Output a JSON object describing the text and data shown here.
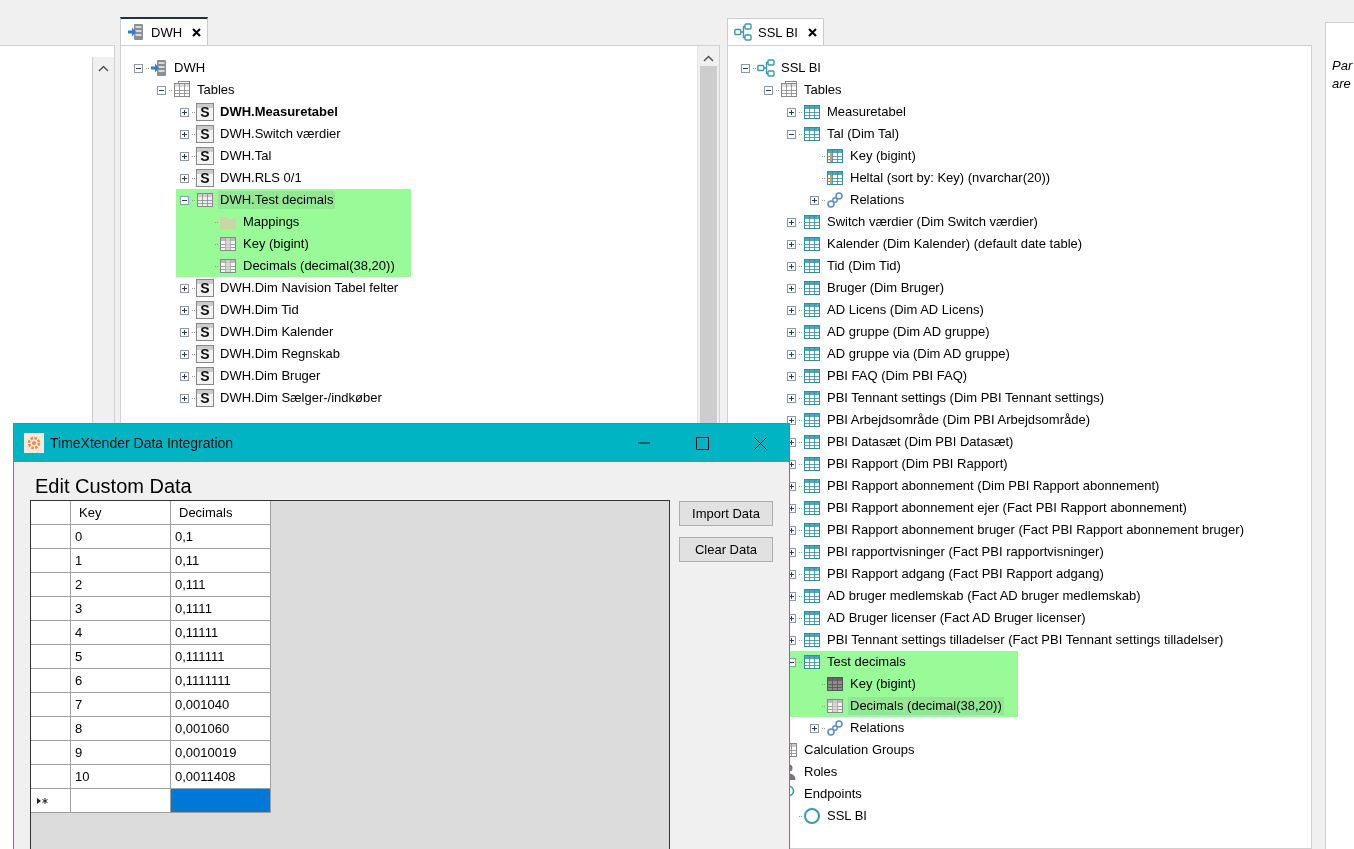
{
  "dwh_pane": {
    "tab": {
      "label": "DWH",
      "kind": "server"
    },
    "tree": [
      {
        "label": "DWH",
        "kind": "server",
        "expanded": true,
        "selected": false,
        "children": [
          {
            "label": "Tables",
            "kind": "tables",
            "expanded": true,
            "selected": false,
            "children": [
              {
                "label": "DWH.Measuretabel",
                "kind": "lettered",
                "icon_letter": "S",
                "expanded": false,
                "selected": false,
                "bold": true,
                "highlighted": false
              },
              {
                "label": "DWH.Switch værdier",
                "kind": "lettered",
                "icon_letter": "S",
                "expanded": false,
                "selected": false,
                "bold": false,
                "highlighted": false
              },
              {
                "label": "DWH.Tal",
                "kind": "lettered",
                "icon_letter": "S",
                "expanded": false,
                "selected": false,
                "bold": false,
                "highlighted": false
              },
              {
                "label": "DWH.RLS 0/1",
                "kind": "lettered",
                "icon_letter": "S",
                "expanded": false,
                "selected": false,
                "bold": false,
                "highlighted": false
              },
              {
                "label": "DWH.Test decimals",
                "kind": "grid",
                "expanded": true,
                "selected": true,
                "bold": false,
                "highlighted": true,
                "children": [
                  {
                    "label": "Mappings",
                    "kind": "folder",
                    "selected": false,
                    "highlighted": true
                  },
                  {
                    "label": "Key (bigint)",
                    "kind": "column",
                    "selected": false,
                    "highlighted": true
                  },
                  {
                    "label": "Decimals (decimal(38,20))",
                    "kind": "column",
                    "selected": false,
                    "highlighted": true
                  }
                ]
              },
              {
                "label": "DWH.Dim Navision Tabel felter",
                "kind": "lettered",
                "icon_letter": "S",
                "expanded": false,
                "selected": false,
                "bold": false,
                "highlighted": false
              },
              {
                "label": "DWH.Dim Tid",
                "kind": "lettered",
                "icon_letter": "S",
                "expanded": false,
                "selected": false,
                "bold": false,
                "highlighted": false
              },
              {
                "label": "DWH.Dim Kalender",
                "kind": "lettered",
                "icon_letter": "S",
                "expanded": false,
                "selected": false,
                "bold": false,
                "highlighted": false
              },
              {
                "label": "DWH.Dim Regnskab",
                "kind": "lettered",
                "icon_letter": "S",
                "expanded": false,
                "selected": false,
                "bold": false,
                "highlighted": false
              },
              {
                "label": "DWH.Dim Bruger",
                "kind": "lettered",
                "icon_letter": "S",
                "expanded": false,
                "selected": false,
                "bold": false,
                "highlighted": false
              },
              {
                "label": "DWH.Dim Sælger-/indkøber",
                "kind": "lettered",
                "icon_letter": "S",
                "expanded": false,
                "selected": false,
                "bold": false,
                "highlighted": false
              }
            ]
          }
        ]
      }
    ]
  },
  "ssl_pane": {
    "tab": {
      "label": "SSL BI",
      "kind": "model"
    },
    "tree": [
      {
        "label": "SSL BI",
        "kind": "model",
        "expanded": true,
        "selected": false,
        "children": [
          {
            "label": "Tables",
            "kind": "tables",
            "expanded": true,
            "selected": false,
            "children": [
              {
                "label": "Measuretabel",
                "kind": "table",
                "expanded": false,
                "selected": false,
                "highlighted": false
              },
              {
                "label": "Tal (Dim Tal)",
                "kind": "table",
                "expanded": true,
                "selected": false,
                "highlighted": false,
                "children": [
                  {
                    "label": "Key (bigint)",
                    "kind": "columnaccent",
                    "selected": false
                  },
                  {
                    "label": "Heltal (sort by: Key) (nvarchar(20))",
                    "kind": "columnaccent",
                    "selected": false
                  },
                  {
                    "label": "Relations",
                    "kind": "relations",
                    "expanded": false,
                    "selected": false
                  }
                ]
              },
              {
                "label": "Switch værdier (Dim Switch værdier)",
                "kind": "table",
                "expanded": false,
                "selected": false,
                "highlighted": false
              },
              {
                "label": "Kalender (Dim Kalender) (default date table)",
                "kind": "table",
                "expanded": false,
                "selected": false,
                "highlighted": false
              },
              {
                "label": "Tid (Dim Tid)",
                "kind": "table",
                "expanded": false,
                "selected": false,
                "highlighted": false
              },
              {
                "label": "Bruger (Dim Bruger)",
                "kind": "table",
                "expanded": false,
                "selected": false,
                "highlighted": false
              },
              {
                "label": "AD Licens (Dim AD Licens)",
                "kind": "table",
                "expanded": false,
                "selected": false,
                "highlighted": false
              },
              {
                "label": "AD gruppe (Dim AD gruppe)",
                "kind": "table",
                "expanded": false,
                "selected": false,
                "highlighted": false
              },
              {
                "label": "AD gruppe via (Dim AD gruppe)",
                "kind": "table",
                "expanded": false,
                "selected": false,
                "highlighted": false
              },
              {
                "label": "PBI FAQ (Dim PBI FAQ)",
                "kind": "table",
                "expanded": false,
                "selected": false,
                "highlighted": false
              },
              {
                "label": "PBI Tennant settings (Dim PBI Tennant settings)",
                "kind": "table",
                "expanded": false,
                "selected": false,
                "highlighted": false
              },
              {
                "label": "PBI Arbejdsområde (Dim PBI Arbejdsområde)",
                "kind": "table",
                "expanded": false,
                "selected": false,
                "highlighted": false
              },
              {
                "label": "PBI Datasæt (Dim PBI Datasæt)",
                "kind": "table",
                "expanded": false,
                "selected": false,
                "highlighted": false
              },
              {
                "label": "PBI Rapport (Dim PBI Rapport)",
                "kind": "table",
                "expanded": false,
                "selected": false,
                "highlighted": false
              },
              {
                "label": "PBI Rapport abonnement (Dim PBI Rapport abonnement)",
                "kind": "table",
                "expanded": false,
                "selected": false,
                "highlighted": false
              },
              {
                "label": "PBI Rapport abonnement ejer (Fact PBI Rapport abonnement)",
                "kind": "table",
                "expanded": false,
                "selected": false,
                "highlighted": false
              },
              {
                "label": "PBI Rapport abonnement bruger (Fact PBI Rapport abonnement bruger)",
                "kind": "table",
                "expanded": false,
                "selected": false,
                "highlighted": false
              },
              {
                "label": "PBI rapportvisninger (Fact PBI rapportvisninger)",
                "kind": "table",
                "expanded": false,
                "selected": false,
                "highlighted": false
              },
              {
                "label": "PBI Rapport adgang (Fact PBI Rapport adgang)",
                "kind": "table",
                "expanded": false,
                "selected": false,
                "highlighted": false
              },
              {
                "label": "AD bruger medlemskab (Fact AD bruger medlemskab)",
                "kind": "table",
                "expanded": false,
                "selected": false,
                "highlighted": false
              },
              {
                "label": "AD Bruger licenser (Fact AD Bruger licenser)",
                "kind": "table",
                "expanded": false,
                "selected": false,
                "highlighted": false
              },
              {
                "label": "PBI Tennant settings tilladelser (Fact PBI Tennant settings tilladelser)",
                "kind": "table",
                "expanded": false,
                "selected": false,
                "highlighted": false
              },
              {
                "label": "Test decimals",
                "kind": "table",
                "expanded": true,
                "selected": false,
                "highlighted": true,
                "children": [
                  {
                    "label": "Key (bigint)",
                    "kind": "columnkey",
                    "selected": false,
                    "highlighted": true
                  },
                  {
                    "label": "Decimals (decimal(38,20))",
                    "kind": "column",
                    "selected": true,
                    "highlighted": true
                  },
                  {
                    "label": "Relations",
                    "kind": "relations",
                    "expanded": false,
                    "selected": false,
                    "highlighted": false
                  }
                ]
              }
            ]
          },
          {
            "label": "Calculation Groups",
            "kind": "calc",
            "selected": false
          },
          {
            "label": "Roles",
            "kind": "roles",
            "selected": false
          },
          {
            "label": "Endpoints",
            "kind": "endpoints",
            "selected": false,
            "children": [
              {
                "label": "SSL BI",
                "kind": "endpoint",
                "selected": false
              }
            ]
          }
        ]
      }
    ]
  },
  "properties_pane": {
    "lines": [
      "Par",
      "are"
    ]
  },
  "dialog": {
    "title": "TimeXtender Data Integration",
    "heading": "Edit Custom Data",
    "grid": {
      "columns": [
        "Key",
        "Decimals"
      ],
      "rows": [
        [
          "0",
          "0,1"
        ],
        [
          "1",
          "0,11"
        ],
        [
          "2",
          "0,111"
        ],
        [
          "3",
          "0,1111"
        ],
        [
          "4",
          "0,11111"
        ],
        [
          "5",
          "0,111111"
        ],
        [
          "6",
          "0,1111111"
        ],
        [
          "7",
          "0,001040"
        ],
        [
          "8",
          "0,001060"
        ],
        [
          "9",
          "0,0010019"
        ],
        [
          "10",
          "0,0011408"
        ]
      ],
      "new_row": {
        "cells": [
          {
            "selected": false
          },
          {
            "selected": true
          }
        ]
      }
    },
    "buttons": [
      "Import Data",
      "Clear Data"
    ]
  }
}
